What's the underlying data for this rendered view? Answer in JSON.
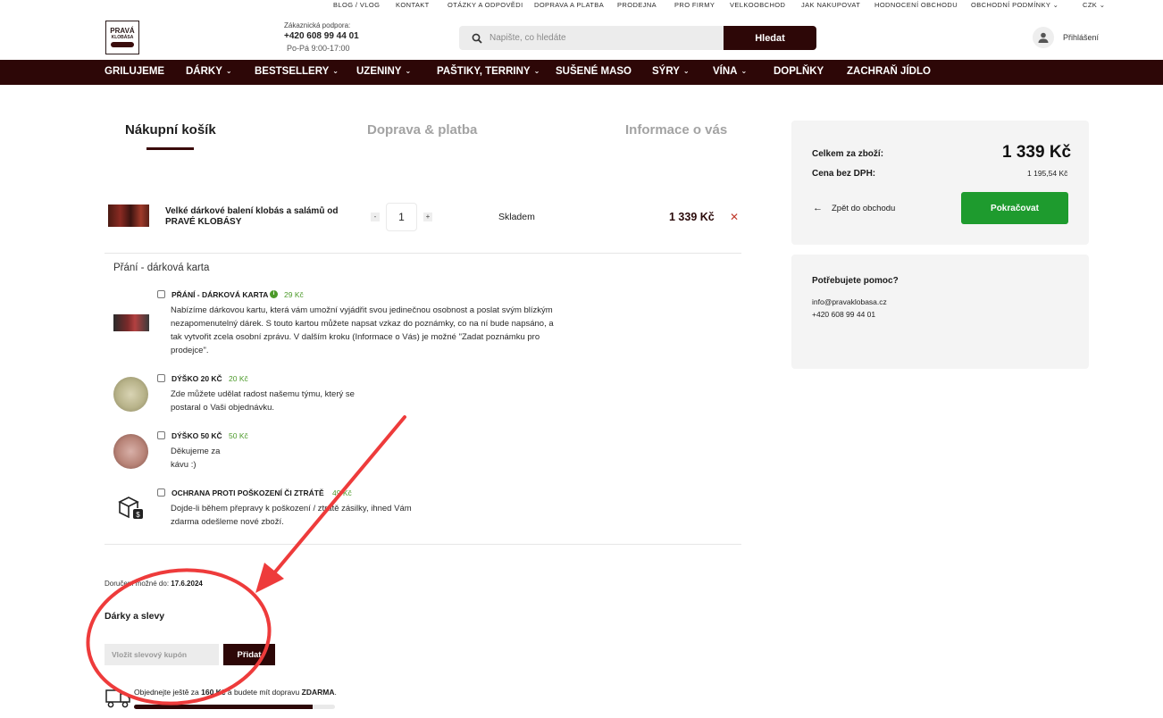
{
  "topbar": {
    "links": [
      "BLOG / VLOG",
      "KONTAKT",
      "OTÁZKY A ODPOVĚDI",
      "DOPRAVA A PLATBA",
      "PRODEJNA",
      "PRO FIRMY",
      "VELKOOBCHOD",
      "JAK NAKUPOVAT",
      "HODNOCENÍ OBCHODU",
      "OBCHODNÍ PODMÍNKY"
    ],
    "currency": "CZK"
  },
  "header": {
    "logo_line1": "PRAVÁ",
    "logo_line2": "KLOBÁSA",
    "support_label": "Zákaznická podpora:",
    "support_phone": "+420 608 99 44 01",
    "support_hours": "Po-Pá 9:00-17:00",
    "search_placeholder": "Napište, co hledáte",
    "search_button": "Hledat",
    "login": "Přihlášení"
  },
  "nav": {
    "items": [
      {
        "label": "GRILUJEME",
        "chev": ""
      },
      {
        "label": "DÁRKY",
        "chev": "⌄"
      },
      {
        "label": "BESTSELLERY",
        "chev": "⌄"
      },
      {
        "label": "UZENINY",
        "chev": "⌄"
      },
      {
        "label": "PAŠTIKY, TERRINY",
        "chev": "⌄"
      },
      {
        "label": "SUŠENÉ MASO",
        "chev": ""
      },
      {
        "label": "SÝRY",
        "chev": "⌄"
      },
      {
        "label": "VÍNA",
        "chev": "⌄"
      },
      {
        "label": "DOPLŇKY",
        "chev": ""
      },
      {
        "label": "ZACHRAŇ JÍDLO",
        "chev": ""
      }
    ]
  },
  "steps": [
    "Nákupní košík",
    "Doprava & platba",
    "Informace o vás"
  ],
  "cart": {
    "product_name": "Velké dárkové balení klobás a salámů od PRAVÉ KLOBÁSY",
    "qty_minus": "-",
    "qty_plus": "+",
    "quantity": "1",
    "stock": "Skladem",
    "price": "1 339 Kč",
    "remove": "✕"
  },
  "addons_section_title": "Přání - dárková karta",
  "addons": [
    {
      "title": "PŘÁNÍ - DÁRKOVÁ KARTA",
      "price": "29 Kč",
      "desc": "Nabízíme dárkovou kartu, která vám umožní vyjádřit svou jedinečnou osobnost a poslat svým blízkým nezapomenutelný dárek. S touto kartou můžete napsat vzkaz do poznámky, co na ní bude napsáno, a tak vytvořit zcela osobní zprávu. V dalším kroku (Informace o Vás) je možné \"Zadat poznámku pro prodejce\"."
    },
    {
      "title": "DÝŠKO 20 KČ",
      "price": "20 Kč",
      "desc": "Zde můžete udělat radost našemu týmu, který se postaral o Vaši objednávku."
    },
    {
      "title": "DÝŠKO 50 KČ",
      "price": "50 Kč",
      "desc": "Děkujeme za kávu :)"
    },
    {
      "title": "OCHRANA PROTI POŠKOZENÍ ČI ZTRÁTĚ",
      "price": "49 Kč",
      "desc": "Dojde-li během přepravy k poškození / ztrátě zásilky, ihned Vám zdarma odešleme nové zboží."
    }
  ],
  "delivery": {
    "label": "Doručení možné do: ",
    "date": "17.6.2024"
  },
  "gifts": {
    "title": "Dárky a slevy",
    "coupon_placeholder": "Vložit slevový kupón",
    "coupon_button": "Přidat"
  },
  "freeship": {
    "prefix": "Objednejte ještě za ",
    "amount": "160 Kč",
    "middle": " a budete mít dopravu ",
    "free": "ZDARMA",
    "suffix": ".",
    "progress_percent": 89
  },
  "summary": {
    "total_label": "Celkem za zboží:",
    "total": "1 339 Kč",
    "novat_label": "Cena bez DPH:",
    "novat": "1 195,54 Kč",
    "back": "Zpět do obchodu",
    "continue": "Pokračovat"
  },
  "help": {
    "title": "Potřebujete pomoc?",
    "email": "info@pravaklobasa.cz",
    "phone": "+420 608 99 44 01"
  },
  "colors": {
    "brand": "#2d0707",
    "green": "#1e9b2e",
    "addon_price": "#4c9a2a",
    "annotation": "#ee3b3b"
  }
}
